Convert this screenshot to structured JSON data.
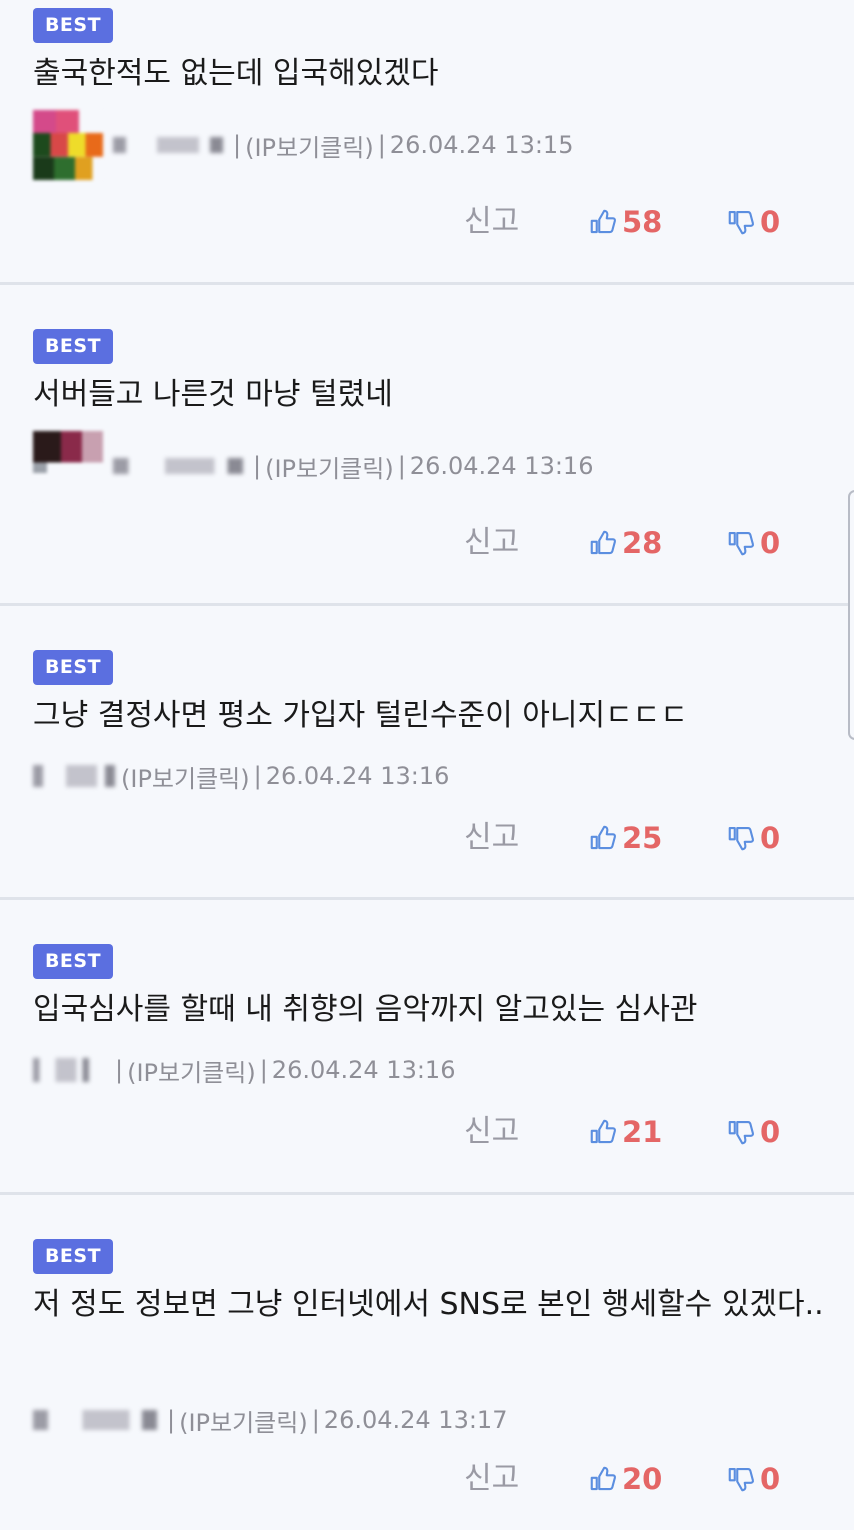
{
  "comments": [
    {
      "badge": "BEST",
      "text": "출국한적도 없는데 입국해있겠다",
      "ip_label": "(IP보기클릭)",
      "timestamp": "26.04.24 13:15",
      "report_label": "신고",
      "likes": "58",
      "dislikes": "0"
    },
    {
      "badge": "BEST",
      "text": "서버들고 나른것 마냥 털렸네",
      "ip_label": "(IP보기클릭)",
      "timestamp": "26.04.24 13:16",
      "report_label": "신고",
      "likes": "28",
      "dislikes": "0"
    },
    {
      "badge": "BEST",
      "text": "그냥 결정사면 평소 가입자 털린수준이 아니지ㄷㄷㄷ",
      "ip_label": "(IP보기클릭)",
      "timestamp": "26.04.24 13:16",
      "report_label": "신고",
      "likes": "25",
      "dislikes": "0"
    },
    {
      "badge": "BEST",
      "text": "입국심사를 할때 내 취향의 음악까지 알고있는 심사관",
      "ip_label": "(IP보기클릭)",
      "timestamp": "26.04.24 13:16",
      "report_label": "신고",
      "likes": "21",
      "dislikes": "0"
    },
    {
      "badge": "BEST",
      "text": "저 정도 정보면 그냥 인터넷에서 SNS로 본인 행세할수 있겠다..",
      "ip_label": "(IP보기클릭)",
      "timestamp": "26.04.24 13:17",
      "report_label": "신고",
      "likes": "20",
      "dislikes": "0"
    }
  ],
  "colors": {
    "badge_bg": "#5b6fe0",
    "like_icon": "#5b8ee0",
    "count_text": "#e46666",
    "meta_text": "#8f8f97",
    "background": "#f6f8fc"
  },
  "icons": {
    "like": "thumbs-up-icon",
    "dislike": "thumbs-down-icon"
  }
}
